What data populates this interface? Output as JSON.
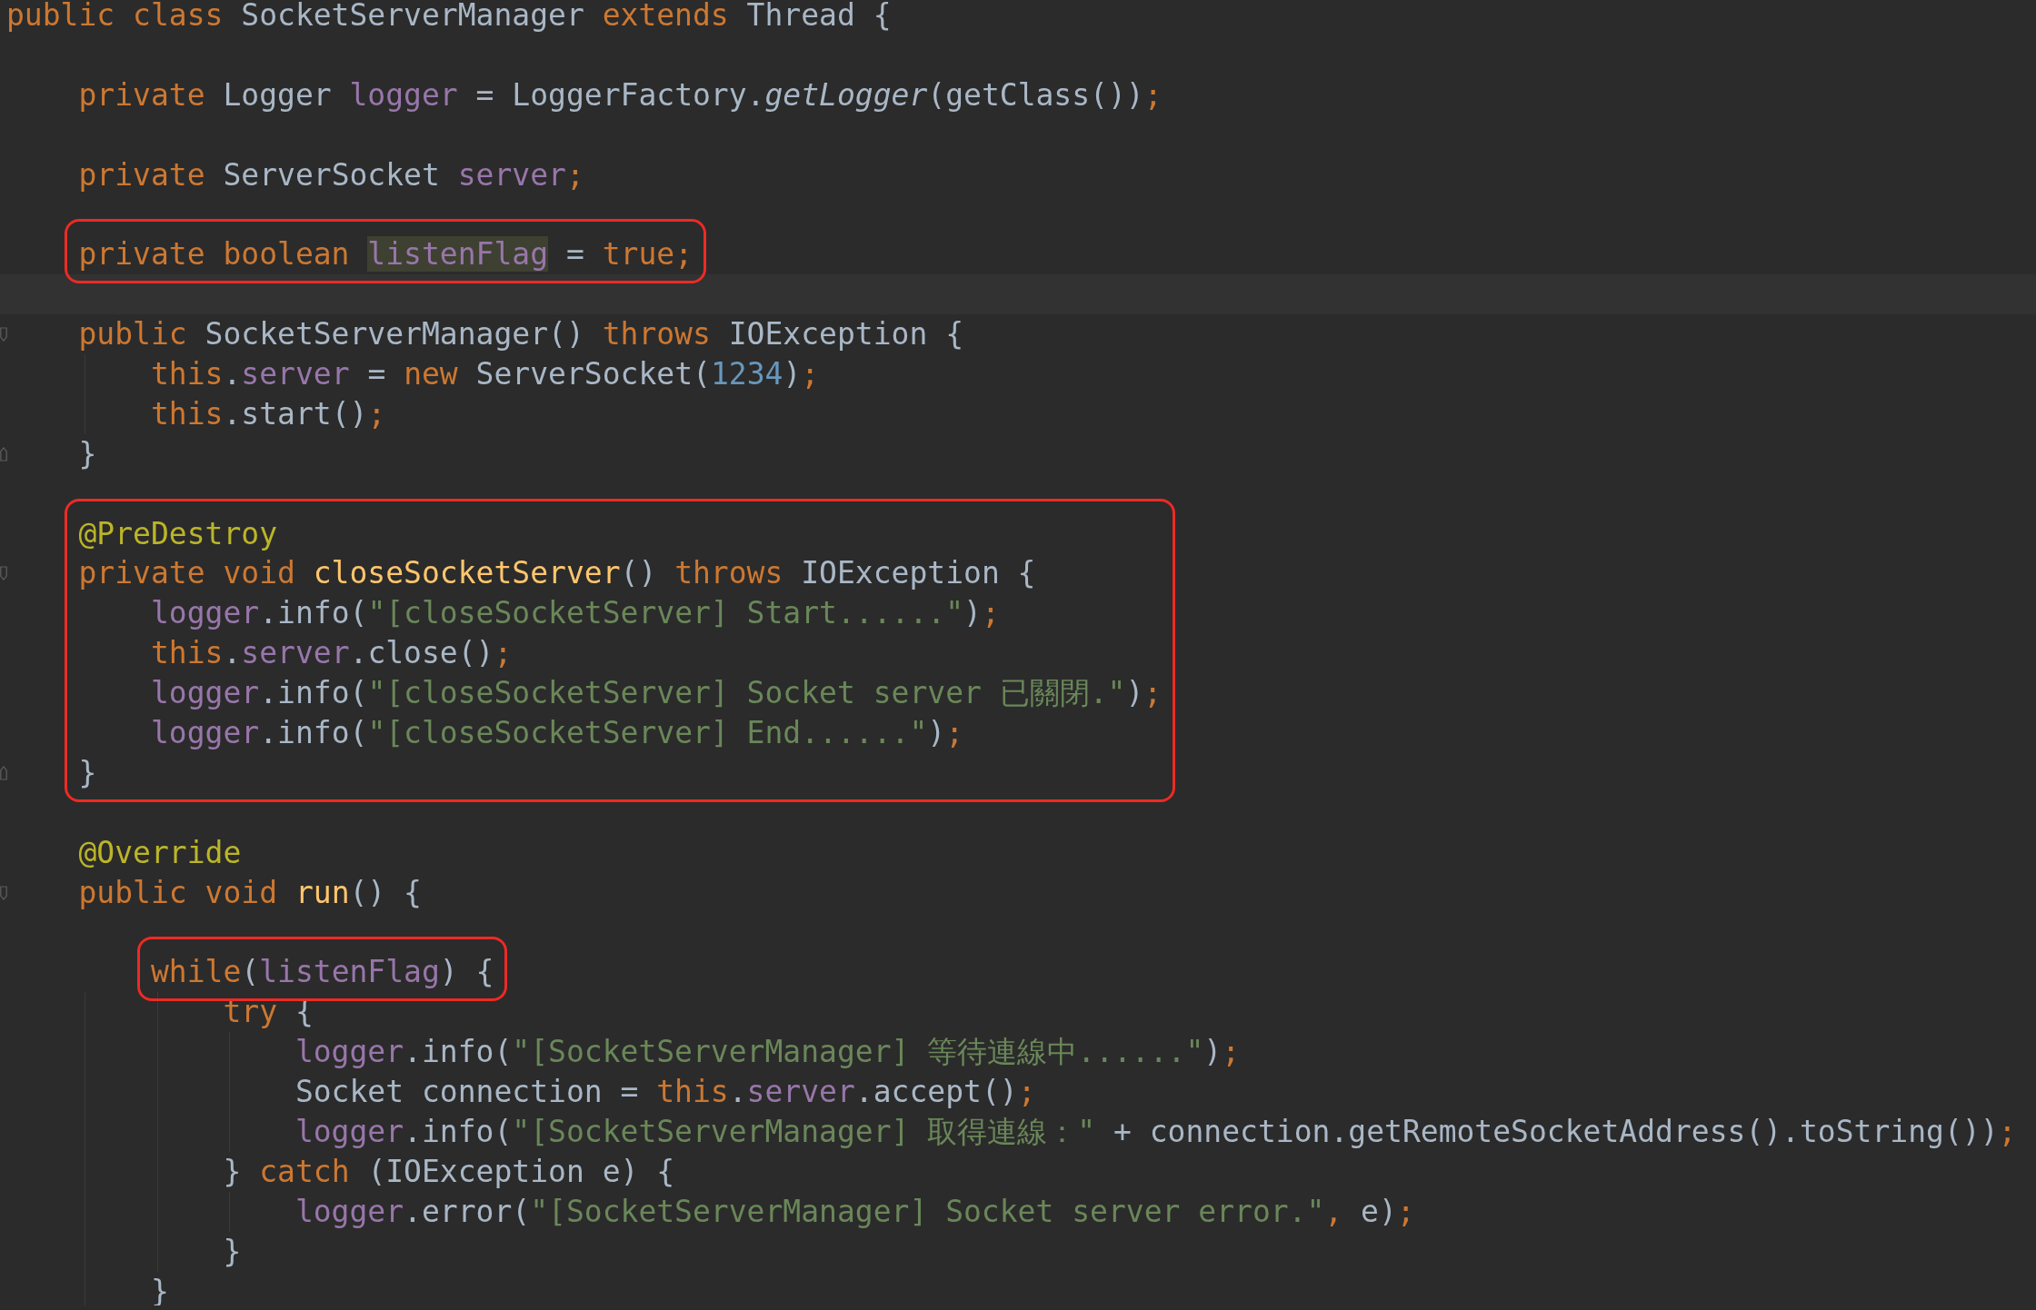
{
  "editor": {
    "blocks": [
      {
        "framed": false,
        "lines": [
          {
            "tokens": [
              {
                "kind": "keyword",
                "text": "public class "
              },
              {
                "kind": "plain",
                "text": "SocketServerManager "
              },
              {
                "kind": "keyword",
                "text": "extends "
              },
              {
                "kind": "plain",
                "text": "Thread {"
              }
            ]
          },
          {
            "current": false
          },
          {
            "tokens": [
              {
                "kind": "keyword",
                "text": "    private "
              },
              {
                "kind": "plain",
                "text": "Logger "
              },
              {
                "kind": "field",
                "text": "logger"
              },
              {
                "kind": "plain",
                "text": " = LoggerFactory."
              },
              {
                "kind": "static",
                "text": "getLogger"
              },
              {
                "kind": "plain",
                "text": "(getClass())"
              },
              {
                "kind": "keyword",
                "text": ";"
              }
            ]
          },
          {
            "current": false
          },
          {
            "tokens": [
              {
                "kind": "keyword",
                "text": "    private "
              },
              {
                "kind": "plain",
                "text": "ServerSocket "
              },
              {
                "kind": "field",
                "text": "server"
              },
              {
                "kind": "keyword",
                "text": ";"
              }
            ]
          },
          {
            "current": false
          }
        ]
      },
      {
        "framed": true,
        "lines": [
          {
            "tokens": [
              {
                "kind": "keyword",
                "text": "    private boolean "
              },
              {
                "kind": "usage",
                "text": "listenFlag"
              },
              {
                "kind": "plain",
                "text": " = "
              },
              {
                "kind": "keyword",
                "text": "true;"
              }
            ]
          }
        ]
      },
      {
        "framed": false,
        "lines": [
          {
            "current": true
          },
          {
            "tokens": [
              {
                "kind": "keyword",
                "text": "    public "
              },
              {
                "kind": "plain",
                "text": "SocketServerManager() "
              },
              {
                "kind": "keyword",
                "text": "throws "
              },
              {
                "kind": "plain",
                "text": "IOException {"
              }
            ],
            "fold_start": true
          },
          {
            "tokens": [
              {
                "kind": "keyword",
                "text": "        this"
              },
              {
                "kind": "plain",
                "text": "."
              },
              {
                "kind": "field",
                "text": "server"
              },
              {
                "kind": "plain",
                "text": " = "
              },
              {
                "kind": "keyword",
                "text": "new "
              },
              {
                "kind": "plain",
                "text": "ServerSocket("
              },
              {
                "kind": "number",
                "text": "1234"
              },
              {
                "kind": "plain",
                "text": ")"
              },
              {
                "kind": "keyword",
                "text": ";"
              }
            ]
          },
          {
            "tokens": [
              {
                "kind": "keyword",
                "text": "        this"
              },
              {
                "kind": "plain",
                "text": ".start()"
              },
              {
                "kind": "keyword",
                "text": ";"
              }
            ]
          },
          {
            "tokens": [
              {
                "kind": "plain",
                "text": "    }"
              }
            ],
            "fold_end": true
          },
          {
            "current": false
          }
        ]
      },
      {
        "framed": true,
        "lines": [
          {
            "tokens": [
              {
                "kind": "annotation",
                "text": "    @PreDestroy"
              }
            ]
          },
          {
            "tokens": [
              {
                "kind": "keyword",
                "text": "    private void "
              },
              {
                "kind": "declaration",
                "text": "closeSocketServer"
              },
              {
                "kind": "plain",
                "text": "() "
              },
              {
                "kind": "keyword",
                "text": "throws "
              },
              {
                "kind": "plain",
                "text": "IOException {"
              }
            ],
            "fold_start": true
          },
          {
            "tokens": [
              {
                "kind": "field",
                "text": "        logger"
              },
              {
                "kind": "plain",
                "text": ".info("
              },
              {
                "kind": "string",
                "text": "\"[closeSocketServer] Start......\""
              },
              {
                "kind": "plain",
                "text": ")"
              },
              {
                "kind": "keyword",
                "text": ";"
              }
            ]
          },
          {
            "tokens": [
              {
                "kind": "keyword",
                "text": "        this"
              },
              {
                "kind": "plain",
                "text": "."
              },
              {
                "kind": "field",
                "text": "server"
              },
              {
                "kind": "plain",
                "text": ".close()"
              },
              {
                "kind": "keyword",
                "text": ";"
              }
            ]
          },
          {
            "tokens": [
              {
                "kind": "field",
                "text": "        logger"
              },
              {
                "kind": "plain",
                "text": ".info("
              },
              {
                "kind": "string",
                "text": "\"[closeSocketServer] Socket server 已關閉.\""
              },
              {
                "kind": "plain",
                "text": ")"
              },
              {
                "kind": "keyword",
                "text": ";"
              }
            ]
          },
          {
            "tokens": [
              {
                "kind": "field",
                "text": "        logger"
              },
              {
                "kind": "plain",
                "text": ".info("
              },
              {
                "kind": "string",
                "text": "\"[closeSocketServer] End......\""
              },
              {
                "kind": "plain",
                "text": ")"
              },
              {
                "kind": "keyword",
                "text": ";"
              }
            ]
          },
          {
            "tokens": [
              {
                "kind": "plain",
                "text": "    }"
              }
            ],
            "fold_end": true
          }
        ]
      },
      {
        "framed": false,
        "lines": [
          {
            "current": false
          },
          {
            "tokens": [
              {
                "kind": "annotation",
                "text": "    @Override"
              }
            ]
          },
          {
            "tokens": [
              {
                "kind": "keyword",
                "text": "    public void "
              },
              {
                "kind": "declaration",
                "text": "run"
              },
              {
                "kind": "plain",
                "text": "() {"
              }
            ],
            "fold_start": true
          },
          {
            "current": false
          }
        ]
      },
      {
        "framed": true,
        "lines": [
          {
            "tokens": [
              {
                "kind": "keyword",
                "text": "        while"
              },
              {
                "kind": "plain",
                "text": "("
              },
              {
                "kind": "field",
                "text": "listenFlag"
              },
              {
                "kind": "plain",
                "text": ") {"
              }
            ]
          }
        ]
      },
      {
        "framed": false,
        "lines": [
          {
            "tokens": [
              {
                "kind": "keyword",
                "text": "            try "
              },
              {
                "kind": "plain",
                "text": "{"
              }
            ]
          },
          {
            "tokens": [
              {
                "kind": "field",
                "text": "                logger"
              },
              {
                "kind": "plain",
                "text": ".info("
              },
              {
                "kind": "string",
                "text": "\"[SocketServerManager] 等待連線中......\""
              },
              {
                "kind": "plain",
                "text": ")"
              },
              {
                "kind": "keyword",
                "text": ";"
              }
            ]
          },
          {
            "tokens": [
              {
                "kind": "plain",
                "text": "                Socket connection = "
              },
              {
                "kind": "keyword",
                "text": "this"
              },
              {
                "kind": "plain",
                "text": "."
              },
              {
                "kind": "field",
                "text": "server"
              },
              {
                "kind": "plain",
                "text": ".accept()"
              },
              {
                "kind": "keyword",
                "text": ";"
              }
            ]
          },
          {
            "tokens": [
              {
                "kind": "field",
                "text": "                logger"
              },
              {
                "kind": "plain",
                "text": ".info("
              },
              {
                "kind": "string",
                "text": "\"[SocketServerManager] 取得連線：\""
              },
              {
                "kind": "plain",
                "text": " + connection.getRemoteSocketAddress().toString())"
              },
              {
                "kind": "keyword",
                "text": ";"
              }
            ]
          },
          {
            "tokens": [
              {
                "kind": "plain",
                "text": "            } "
              },
              {
                "kind": "keyword",
                "text": "catch "
              },
              {
                "kind": "plain",
                "text": "(IOException e) {"
              }
            ]
          },
          {
            "tokens": [
              {
                "kind": "field",
                "text": "                logger"
              },
              {
                "kind": "plain",
                "text": ".error("
              },
              {
                "kind": "string",
                "text": "\"[SocketServerManager] Socket server error.\""
              },
              {
                "kind": "keyword",
                "text": ", "
              },
              {
                "kind": "plain",
                "text": "e)"
              },
              {
                "kind": "keyword",
                "text": ";"
              }
            ]
          },
          {
            "tokens": [
              {
                "kind": "plain",
                "text": "            }"
              }
            ]
          },
          {
            "tokens": [
              {
                "kind": "plain",
                "text": "        }"
              }
            ]
          }
        ]
      }
    ]
  }
}
